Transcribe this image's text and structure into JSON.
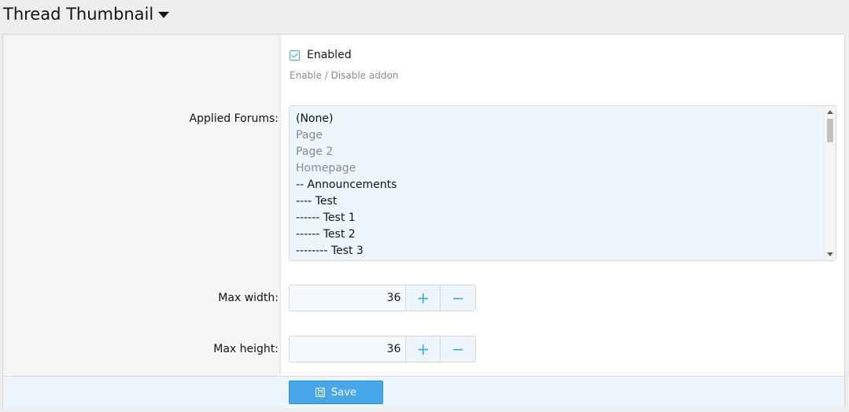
{
  "header": {
    "title": "Thread Thumbnail"
  },
  "enabled": {
    "label": "Enabled",
    "checked": true,
    "hint": "Enable / Disable addon"
  },
  "forums": {
    "label": "Applied Forums:",
    "items": [
      {
        "text": "(None)",
        "muted": false
      },
      {
        "text": "Page",
        "muted": true
      },
      {
        "text": "Page 2",
        "muted": true
      },
      {
        "text": "Homepage",
        "muted": true
      },
      {
        "text": "-- Announcements",
        "muted": false
      },
      {
        "text": "---- Test",
        "muted": false
      },
      {
        "text": "------ Test 1",
        "muted": false
      },
      {
        "text": "------ Test 2",
        "muted": false
      },
      {
        "text": "-------- Test 3",
        "muted": false
      }
    ]
  },
  "max_width": {
    "label": "Max width:",
    "value": "36",
    "plus": "+",
    "minus": "−"
  },
  "max_height": {
    "label": "Max height:",
    "value": "36",
    "plus": "+",
    "minus": "−"
  },
  "footer": {
    "save_label": "Save"
  },
  "colors": {
    "accent": "#47a7eb",
    "field_bg": "#edf6fd"
  }
}
